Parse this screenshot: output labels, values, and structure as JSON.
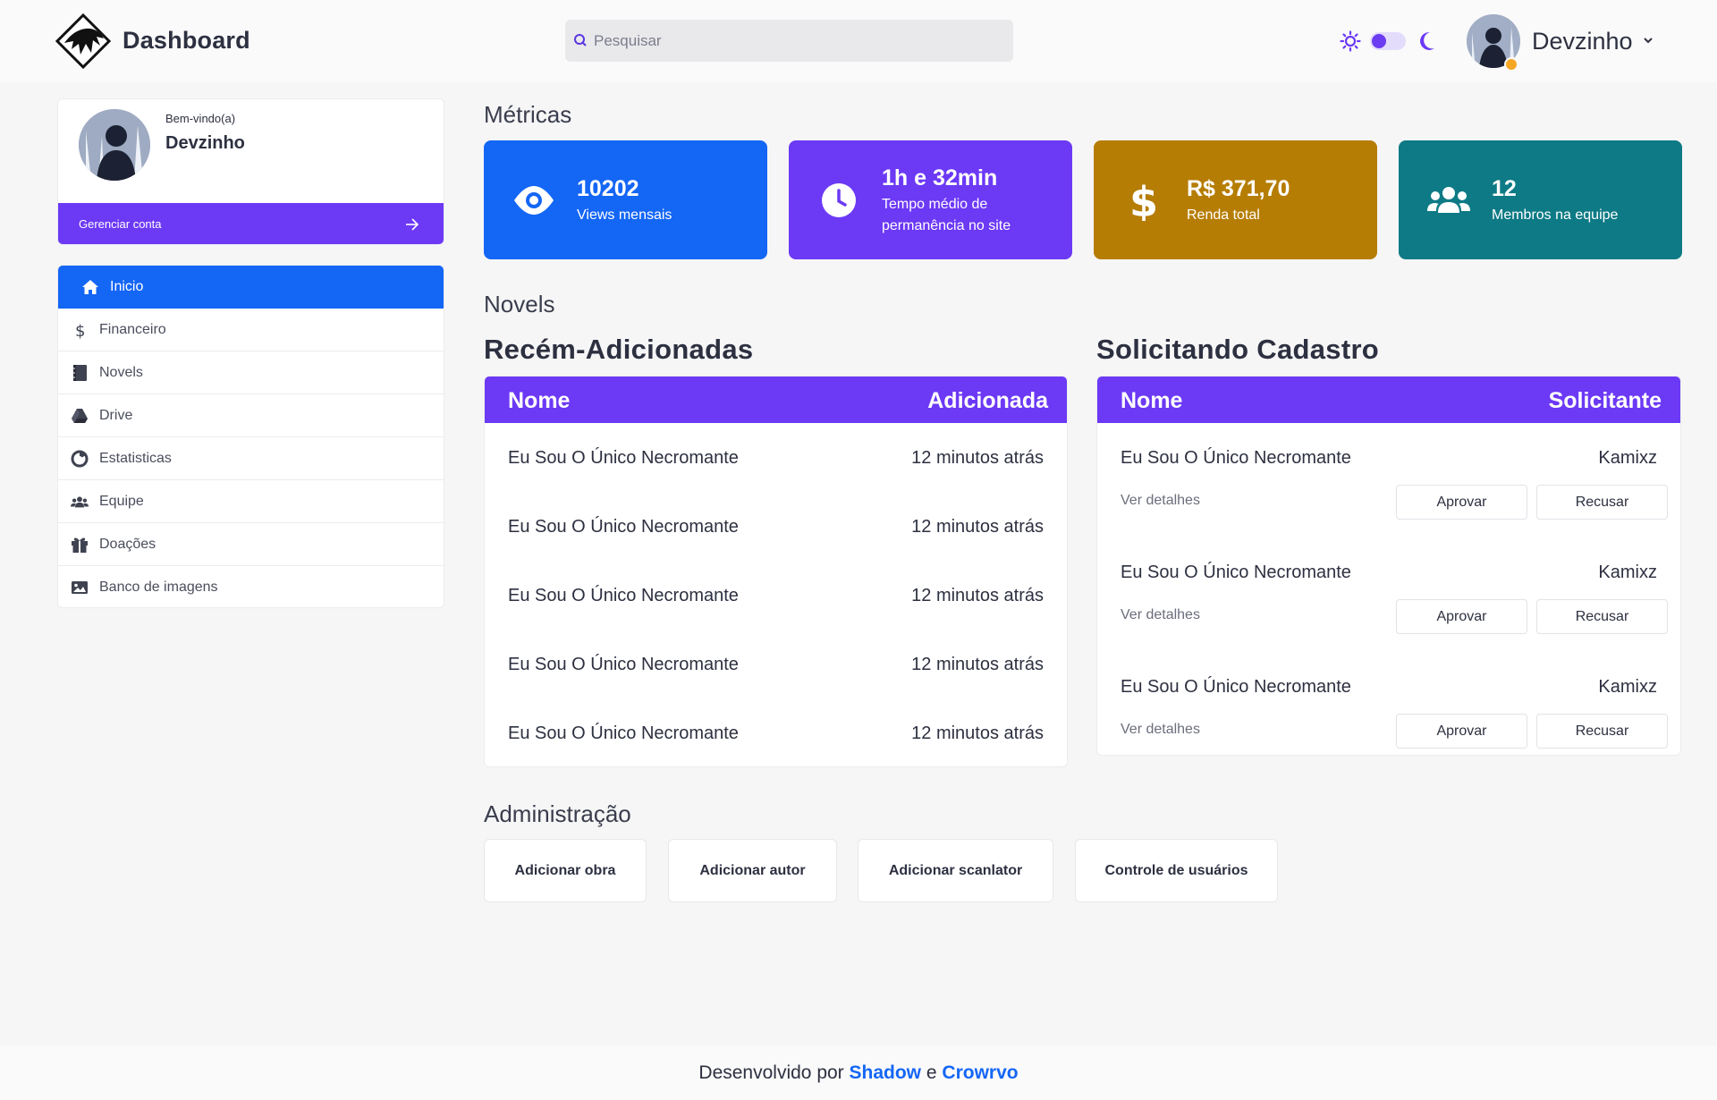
{
  "header": {
    "brand": "Dashboard",
    "search_placeholder": "Pesquisar",
    "user_name": "Devzinho",
    "theme_toggle": "light"
  },
  "sidebar": {
    "welcome": "Bem-vindo(a)",
    "name": "Devzinho",
    "manage_label": "Gerenciar conta",
    "items": [
      {
        "label": "Inicio",
        "icon": "home-icon",
        "active": true
      },
      {
        "label": "Financeiro",
        "icon": "dollar-icon"
      },
      {
        "label": "Novels",
        "icon": "book-icon"
      },
      {
        "label": "Drive",
        "icon": "drive-icon"
      },
      {
        "label": "Estatisticas",
        "icon": "chart-pie-icon"
      },
      {
        "label": "Equipe",
        "icon": "users-icon"
      },
      {
        "label": "Doações",
        "icon": "gift-icon"
      },
      {
        "label": "Banco de imagens",
        "icon": "image-icon"
      }
    ]
  },
  "metrics": {
    "title": "Métricas",
    "cards": [
      {
        "value": "10202",
        "label": "Views mensais",
        "icon": "eye-icon",
        "color": "#1466f5"
      },
      {
        "value": "1h e 32min",
        "label": "Tempo médio de permanência no site",
        "icon": "clock-icon",
        "color": "#6c39f5"
      },
      {
        "value": "R$ 371,70",
        "label": "Renda total",
        "icon": "dollar-icon",
        "color": "#b67d04"
      },
      {
        "value": "12",
        "label": "Membros na equipe",
        "icon": "users-icon",
        "color": "#0d7a85"
      }
    ]
  },
  "novels": {
    "title": "Novels",
    "recent": {
      "title": "Recém-Adicionadas",
      "col_name": "Nome",
      "col_added": "Adicionada",
      "rows": [
        {
          "name": "Eu Sou O Único Necromante",
          "added": "12 minutos atrás"
        },
        {
          "name": "Eu Sou O Único Necromante",
          "added": "12 minutos atrás"
        },
        {
          "name": "Eu Sou O Único Necromante",
          "added": "12 minutos atrás"
        },
        {
          "name": "Eu Sou O Único Necromante",
          "added": "12 minutos atrás"
        },
        {
          "name": "Eu Sou O Único Necromante",
          "added": "12 minutos atrás"
        }
      ]
    },
    "requests": {
      "title": "Solicitando Cadastro",
      "col_name": "Nome",
      "col_requester": "Solicitante",
      "details_label": "Ver detalhes",
      "approve_label": "Aprovar",
      "reject_label": "Recusar",
      "rows": [
        {
          "name": "Eu Sou O Único Necromante",
          "requester": "Kamixz"
        },
        {
          "name": "Eu Sou O Único Necromante",
          "requester": "Kamixz"
        },
        {
          "name": "Eu Sou O Único Necromante",
          "requester": "Kamixz"
        }
      ]
    }
  },
  "admin": {
    "title": "Administração",
    "buttons": [
      "Adicionar obra",
      "Adicionar autor",
      "Adicionar scanlator",
      "Controle de usuários"
    ]
  },
  "footer": {
    "prefix": "Desenvolvido por",
    "author1": "Shadow",
    "conj": "e",
    "author2": "Crowrvo"
  }
}
